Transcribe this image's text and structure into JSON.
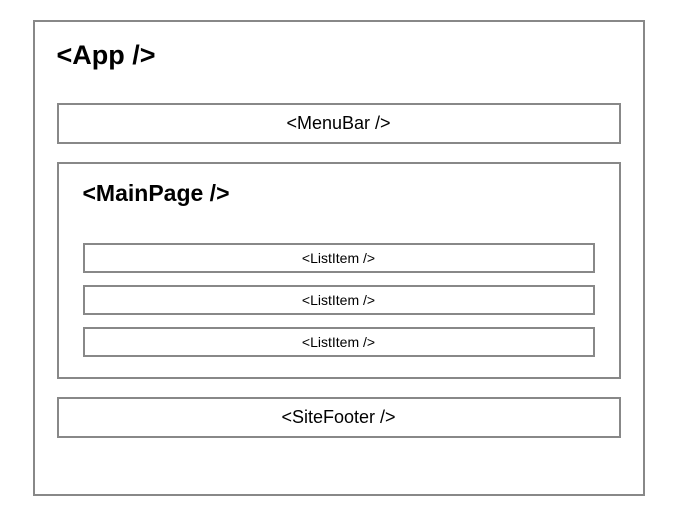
{
  "app": {
    "title": "<App />",
    "menubar": "<MenuBar />",
    "mainpage": {
      "title": "<MainPage />",
      "items": [
        "<ListItem />",
        "<ListItem />",
        "<ListItem />"
      ]
    },
    "footer": "<SiteFooter />"
  }
}
